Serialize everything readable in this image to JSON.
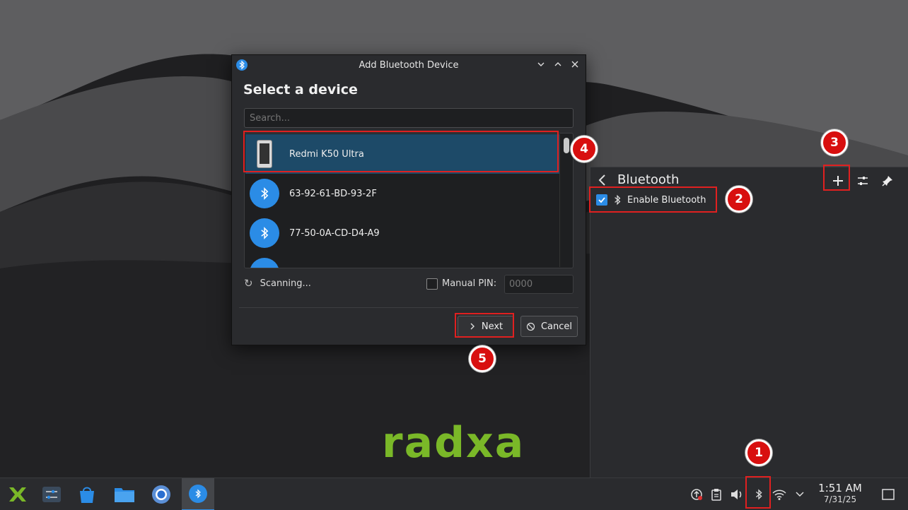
{
  "dialog": {
    "title": "Add Bluetooth Device",
    "heading": "Select a device",
    "search_placeholder": "Search...",
    "devices": [
      {
        "label": "Redmi K50 Ultra",
        "icon": "phone-icon",
        "selected": true
      },
      {
        "label": "63-92-61-BD-93-2F",
        "icon": "bluetooth-icon",
        "selected": false
      },
      {
        "label": "77-50-0A-CD-D4-A9",
        "icon": "bluetooth-icon",
        "selected": false
      },
      {
        "label": "",
        "icon": "bluetooth-icon",
        "selected": false
      }
    ],
    "scanning_label": "Scanning...",
    "manual_pin_label": "Manual PIN:",
    "manual_pin_placeholder": "0000",
    "next_label": "Next",
    "cancel_label": "Cancel"
  },
  "bluetooth_panel": {
    "title": "Bluetooth",
    "enable_label": "Enable Bluetooth",
    "enabled": true
  },
  "taskbar": {
    "time": "1:51 AM",
    "date": "7/31/25"
  },
  "wallpaper": {
    "brand": "radxa"
  },
  "annotations": [
    "1",
    "2",
    "3",
    "4",
    "5"
  ],
  "colors": {
    "accent": "#2b8ce6",
    "selection": "#1d4a68",
    "annotation_red": "#d80f0f",
    "brand_green": "#7ab828"
  }
}
